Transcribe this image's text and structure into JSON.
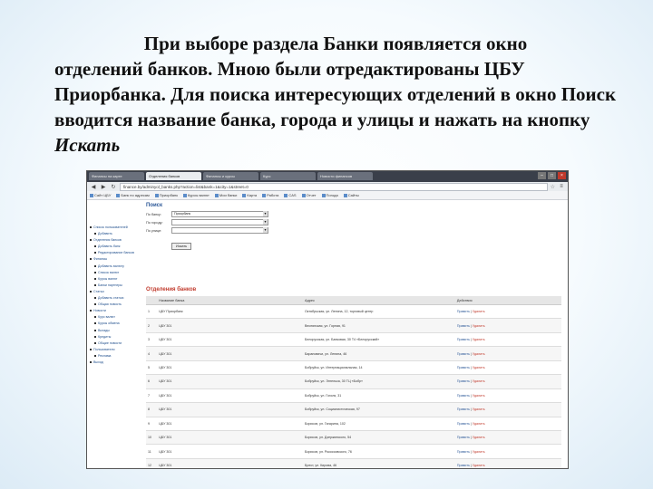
{
  "caption": {
    "line1": "При выборе раздела Банки появляется окно",
    "rest": "отделений банков. Мною были отредактированы ЦБУ Приорбанка. Для поиска интересующих отделений в окно Поиск вводится название банка, города и улицы и нажать на кнопку ",
    "emphasis": "Искать"
  },
  "browser": {
    "tabs": [
      "Финансы на карте",
      "Отделения банков",
      "Финансы и курсы",
      "Курс",
      "Новости финансов"
    ],
    "address": "finance.by/adminyol_banks.php?action=list&bank=1&city=1&street=0",
    "bookmarks": [
      "Сайт ЦБУ",
      "Банк по адресам",
      "Приорбанк",
      "Курсы валют",
      "Мои банки",
      "Карта",
      "Работа",
      "CAS",
      "Отчет",
      "Погода",
      "Сайты"
    ]
  },
  "search": {
    "title": "Поиск",
    "bank_label": "По банку:",
    "bank_value": "Приорбанк",
    "city_label": "По городу:",
    "city_value": "",
    "street_label": "По улице:",
    "street_value": "",
    "button": "Искать"
  },
  "sidebar": {
    "items": [
      {
        "label": "Список пользователей"
      },
      {
        "label": "Добавить"
      },
      {
        "label": "Отделения банков"
      },
      {
        "label": "Добавить банк"
      },
      {
        "label": "Редактирование банков"
      },
      {
        "label": "Финансы"
      },
      {
        "label": "Добавить валюту"
      },
      {
        "label": "Список валют"
      },
      {
        "label": "Курсы валют"
      },
      {
        "label": "Банки партнеры"
      },
      {
        "label": "Статьи"
      },
      {
        "label": "Добавить статью"
      },
      {
        "label": "Общая новость"
      },
      {
        "label": "Новости"
      },
      {
        "label": "Курс валют"
      },
      {
        "label": "Курсы обмена"
      },
      {
        "label": "Вклады"
      },
      {
        "label": "Кредиты"
      },
      {
        "label": "Общие новости"
      },
      {
        "label": "Пользователи"
      },
      {
        "label": "Реклама"
      },
      {
        "label": "Выход"
      }
    ]
  },
  "branches": {
    "title": "Отделения банков",
    "columns": [
      "",
      "Название банка",
      "Адрес",
      "Действия"
    ],
    "rows": [
      {
        "num": "1",
        "name": "ЦБУ Приорбанк",
        "address": "Октябрьская, ул. Ленина, 12, торговый центр",
        "a": "Править",
        "b": "Удалить"
      },
      {
        "num": "2",
        "name": "ЦБУ 301",
        "address": "Веснянская, ул. Горная, 91",
        "a": "Править",
        "b": "Удалить"
      },
      {
        "num": "3",
        "name": "ЦБУ 301",
        "address": "Белорусская, ул. Банковая, 30 Т4 «Белорусский»",
        "a": "Править",
        "b": "Удалить"
      },
      {
        "num": "4",
        "name": "ЦБУ 301",
        "address": "Барановичи, ул. Ленина, 46",
        "a": "Править",
        "b": "Удалить"
      },
      {
        "num": "5",
        "name": "ЦБУ 301",
        "address": "Бобруйск, ул. Интернациональная, 14",
        "a": "Править",
        "b": "Удалить"
      },
      {
        "num": "6",
        "name": "ЦБУ 301",
        "address": "Бобруйск, ул. Энгельса, 30 ТЦ «Бобр»",
        "a": "Править",
        "b": "Удалить"
      },
      {
        "num": "7",
        "name": "ЦБУ 301",
        "address": "Бобруйск, ул. Гоголя, 31",
        "a": "Править",
        "b": "Удалить"
      },
      {
        "num": "8",
        "name": "ЦБУ 301",
        "address": "Бобруйск, ул. Социалистическая, 97",
        "a": "Править",
        "b": "Удалить"
      },
      {
        "num": "9",
        "name": "ЦБУ 301",
        "address": "Борисов, ул. Гагарина, 102",
        "a": "Править",
        "b": "Удалить"
      },
      {
        "num": "10",
        "name": "ЦБУ 301",
        "address": "Борисов, ул. Дзержинского, 54",
        "a": "Править",
        "b": "Удалить"
      },
      {
        "num": "11",
        "name": "ЦБУ 301",
        "address": "Борисов, ул. Рокоссовского, 76",
        "a": "Править",
        "b": "Удалить"
      },
      {
        "num": "12",
        "name": "ЦБУ 301",
        "address": "Брест, ул. Кирова, 46",
        "a": "Править",
        "b": "Удалить"
      }
    ]
  }
}
